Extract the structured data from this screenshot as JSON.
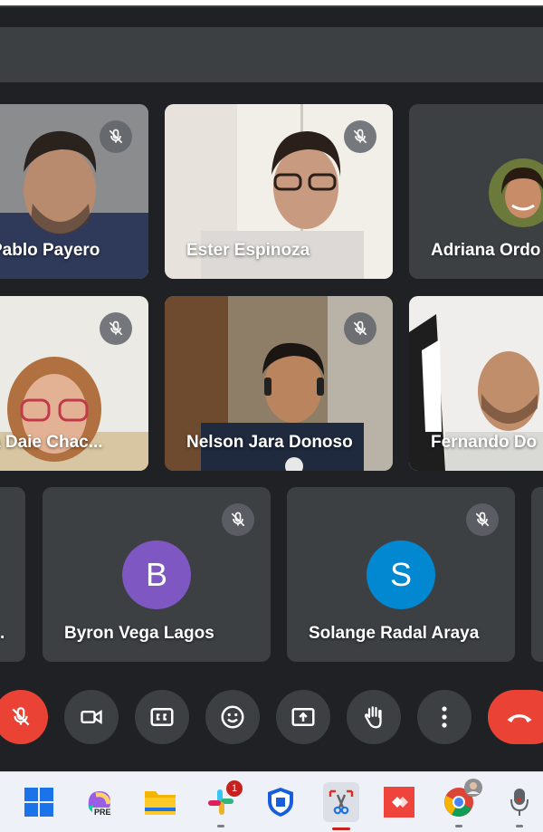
{
  "participants": {
    "pablo": {
      "name": "Pablo Payero"
    },
    "ester": {
      "name": "Ester Espinoza"
    },
    "adriana": {
      "name": "Adriana Ordo"
    },
    "daie": {
      "name": "a Daie Chac..."
    },
    "nelson": {
      "name": "Nelson Jara Donoso"
    },
    "fernando": {
      "name": "Fernando Do"
    },
    "byron": {
      "name": "Byron Vega Lagos",
      "initial": "B",
      "color": "#7e57c2"
    },
    "solange": {
      "name": "Solange Radal Araya",
      "initial": "S",
      "color": "#0288d1"
    }
  },
  "partial_tile_left": {
    "text": "."
  },
  "controls": {
    "mic": "mic-off-icon",
    "camera": "camera-icon",
    "captions": "cc",
    "reactions": "emoji-icon",
    "present": "present-icon",
    "hand": "hand-icon",
    "more": "more-icon",
    "leave": "end-call-icon"
  },
  "taskbar": {
    "slack_badge": "1",
    "copilot_label": "PRE",
    "apps": [
      "windows-start",
      "copilot",
      "file-explorer",
      "slack",
      "bitwarden",
      "snipping-tool",
      "anydesk",
      "chrome",
      "mic"
    ]
  },
  "colors": {
    "meet_bg": "#202124",
    "tile_bg": "#3c4043",
    "leave_red": "#ea4335"
  }
}
